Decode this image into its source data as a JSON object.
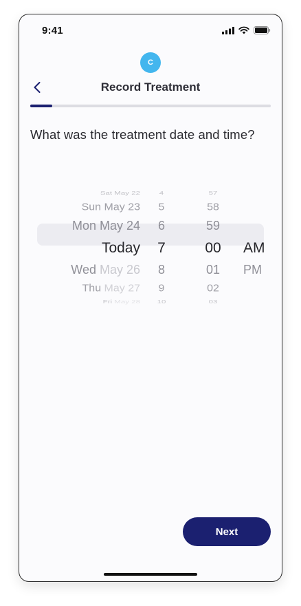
{
  "status_bar": {
    "time": "9:41",
    "icons": [
      "signal-icon",
      "wifi-icon",
      "battery-icon"
    ]
  },
  "avatar": {
    "initial": "C",
    "color": "#43b6ee"
  },
  "header": {
    "title": "Record Treatment",
    "back_icon": "chevron-left-icon"
  },
  "progress": {
    "fraction": 0.09,
    "track_color": "#dcdce2",
    "fill_color": "#1b2070"
  },
  "question": "What was the treatment date and time?",
  "picker": {
    "date": {
      "rows": [
        {
          "label": "Sat May 22"
        },
        {
          "label": "Sun May 23"
        },
        {
          "label": "Mon May 24"
        },
        {
          "label": "Today",
          "selected": true
        },
        {
          "prefix": "Wed ",
          "dim": "May 26"
        },
        {
          "prefix": "Thu ",
          "dim": "May 27"
        },
        {
          "prefix": "Fri ",
          "dim": "May 28"
        }
      ]
    },
    "hour": [
      "4",
      "5",
      "6",
      "7",
      "8",
      "9",
      "10"
    ],
    "minute": [
      "57",
      "58",
      "59",
      "00",
      "01",
      "02",
      "03"
    ],
    "ampm": [
      "AM",
      "PM"
    ],
    "selected_index": 3
  },
  "next_button": {
    "label": "Next",
    "color": "#1b2070"
  }
}
